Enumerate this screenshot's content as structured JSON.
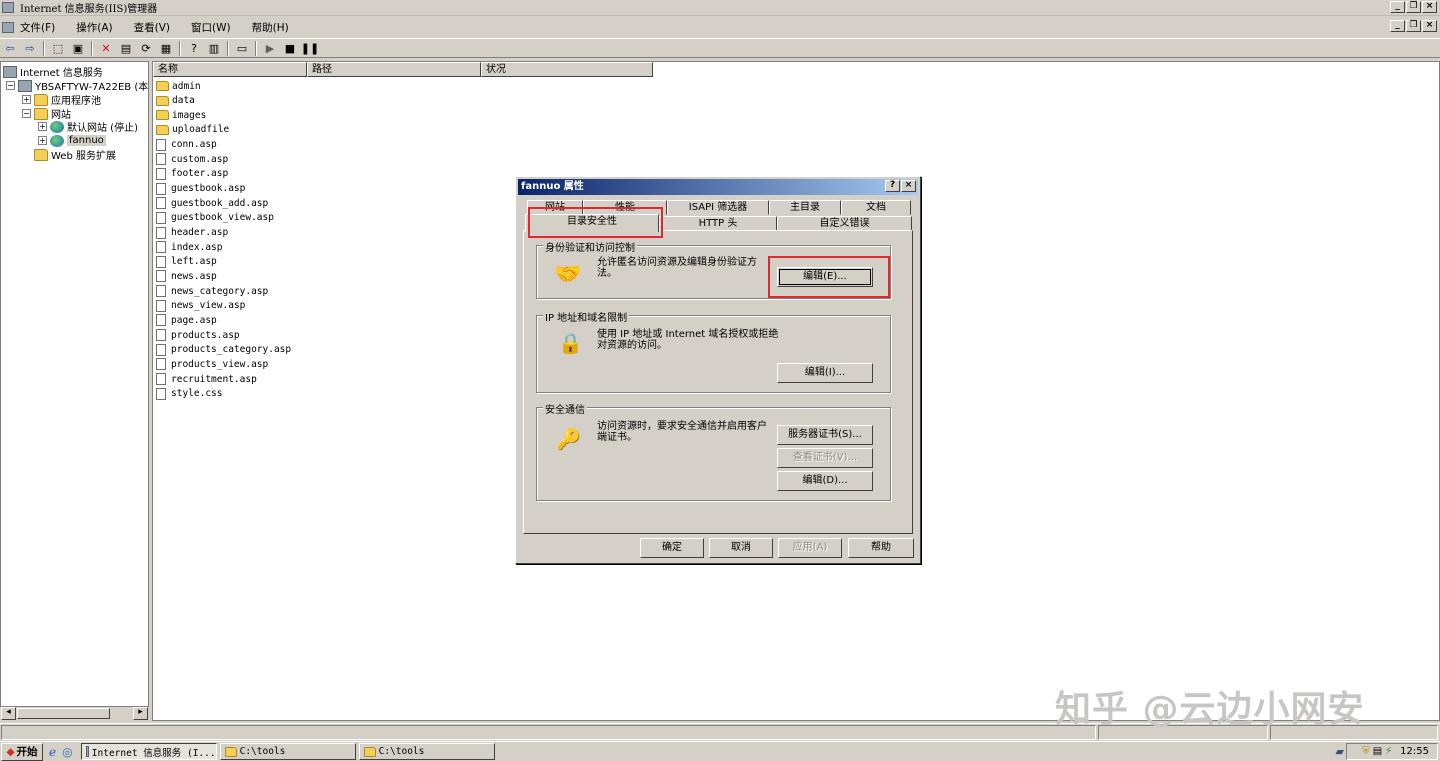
{
  "window": {
    "title": "Internet 信息服务(IIS)管理器"
  },
  "menu": [
    "文件(F)",
    "操作(A)",
    "查看(V)",
    "窗口(W)",
    "帮助(H)"
  ],
  "tree": {
    "root": "Internet 信息服务",
    "server": "YBSAFTYW-7A22EB (本地计",
    "app_pools": "应用程序池",
    "websites": "网站",
    "default_site": "默认网站 (停止)",
    "fannuo": "fannuo",
    "web_ext": "Web 服务扩展"
  },
  "list": {
    "columns": [
      "名称",
      "路径",
      "状况"
    ],
    "folders": [
      "admin",
      "data",
      "images",
      "uploadfile"
    ],
    "files": [
      "conn.asp",
      "custom.asp",
      "footer.asp",
      "guestbook.asp",
      "guestbook_add.asp",
      "guestbook_view.asp",
      "header.asp",
      "index.asp",
      "left.asp",
      "news.asp",
      "news_category.asp",
      "news_view.asp",
      "page.asp",
      "products.asp",
      "products_category.asp",
      "products_view.asp",
      "recruitment.asp",
      "style.css"
    ]
  },
  "dialog": {
    "title": "fannuo 属性",
    "tabs_row1": [
      "网站",
      "性能",
      "ISAPI 筛选器",
      "主目录",
      "文档"
    ],
    "tabs_row2": [
      "目录安全性",
      "HTTP 头",
      "自定义错误"
    ],
    "auth": {
      "title": "身份验证和访问控制",
      "text": "允许匿名访问资源及编辑身份验证方法。",
      "edit": "编辑(E)..."
    },
    "ip": {
      "title": "IP 地址和域名限制",
      "text": "使用 IP 地址或 Internet 域名授权或拒绝对资源的访问。",
      "edit": "编辑(I)..."
    },
    "secure": {
      "title": "安全通信",
      "text": "访问资源时，要求安全通信并启用客户端证书。",
      "server_cert": "服务器证书(S)...",
      "view_cert": "查看证书(V)...",
      "edit": "编辑(D)..."
    },
    "buttons": {
      "ok": "确定",
      "cancel": "取消",
      "apply": "应用(A)",
      "help": "帮助"
    }
  },
  "taskbar": {
    "start": "开始",
    "tasks": [
      "Internet 信息服务 (I...",
      "C:\\tools",
      "C:\\tools"
    ],
    "clock": "12:55"
  },
  "watermark": "知乎 @云边小网安",
  "colors": {
    "highlight": "#e0282e",
    "title_active": "#0a246a"
  }
}
